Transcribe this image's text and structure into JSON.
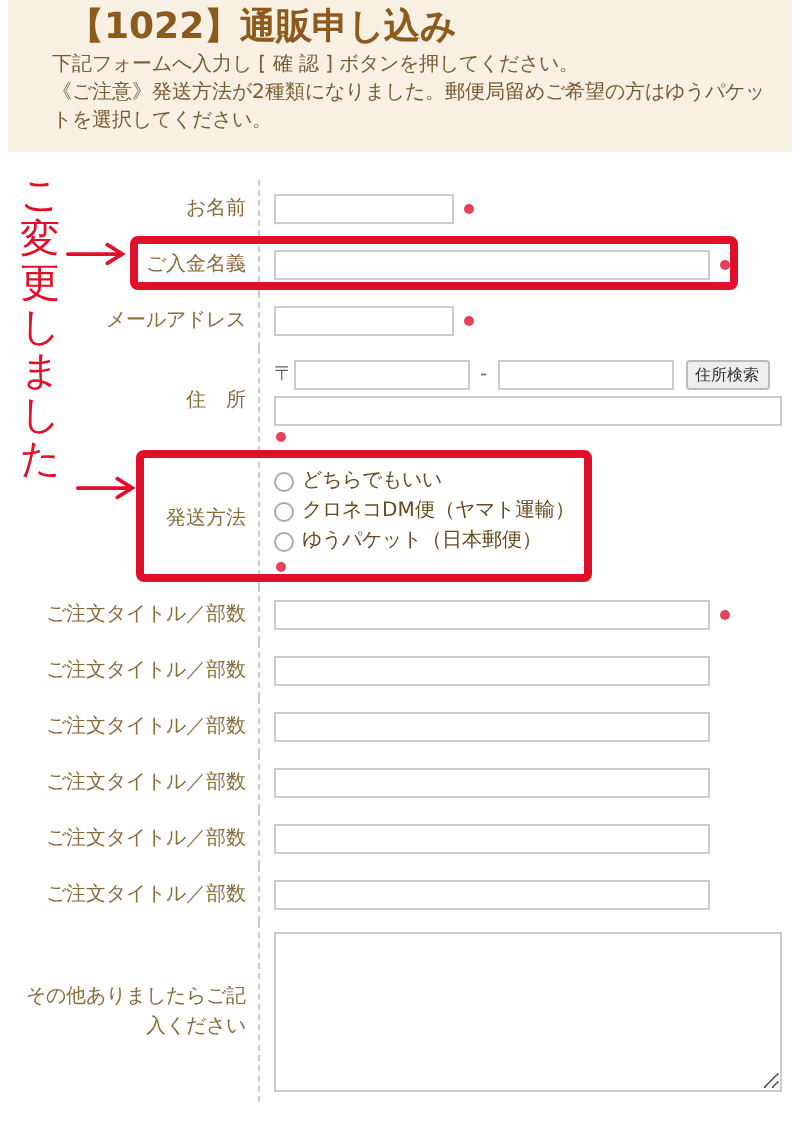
{
  "header": {
    "title": "【1022】通販申し込み",
    "lines": [
      "下記フォームへ入力し [ 確 認 ] ボタンを押してください。",
      "《ご注意》発送方法が2種類になりました。郵便局留めご希望の方はゆうパケットを選択してください。"
    ]
  },
  "fields": [
    {
      "kind": "short_text",
      "label": "お名前",
      "required": true
    },
    {
      "kind": "long_text",
      "label": "ご入金名義",
      "required": true
    },
    {
      "kind": "short_text",
      "label": "メールアドレス",
      "required": true
    },
    {
      "kind": "address",
      "label": "住　所",
      "postal_mark": "〒",
      "separator": "-",
      "button": "住所検索",
      "required": true
    },
    {
      "kind": "radio",
      "label": "発送方法",
      "options": [
        {
          "label": "どちらでもいい",
          "selected": false
        },
        {
          "label": "クロネコDM便（ヤマト運輸）",
          "selected": false
        },
        {
          "label": "ゆうパケット（日本郵便）",
          "selected": false
        }
      ],
      "required": true
    },
    {
      "kind": "long_text",
      "label": "ご注文タイトル／部数",
      "required": true
    },
    {
      "kind": "long_text",
      "label": "ご注文タイトル／部数",
      "required": false
    },
    {
      "kind": "long_text",
      "label": "ご注文タイトル／部数",
      "required": false
    },
    {
      "kind": "long_text",
      "label": "ご注文タイトル／部数",
      "required": false
    },
    {
      "kind": "long_text",
      "label": "ご注文タイトル／部数",
      "required": false
    },
    {
      "kind": "long_text",
      "label": "ご注文タイトル／部数",
      "required": false
    },
    {
      "kind": "textarea",
      "label": "その他ありましたらご記入ください",
      "required": false
    }
  ],
  "annotation": {
    "note": "こ変更しました"
  }
}
